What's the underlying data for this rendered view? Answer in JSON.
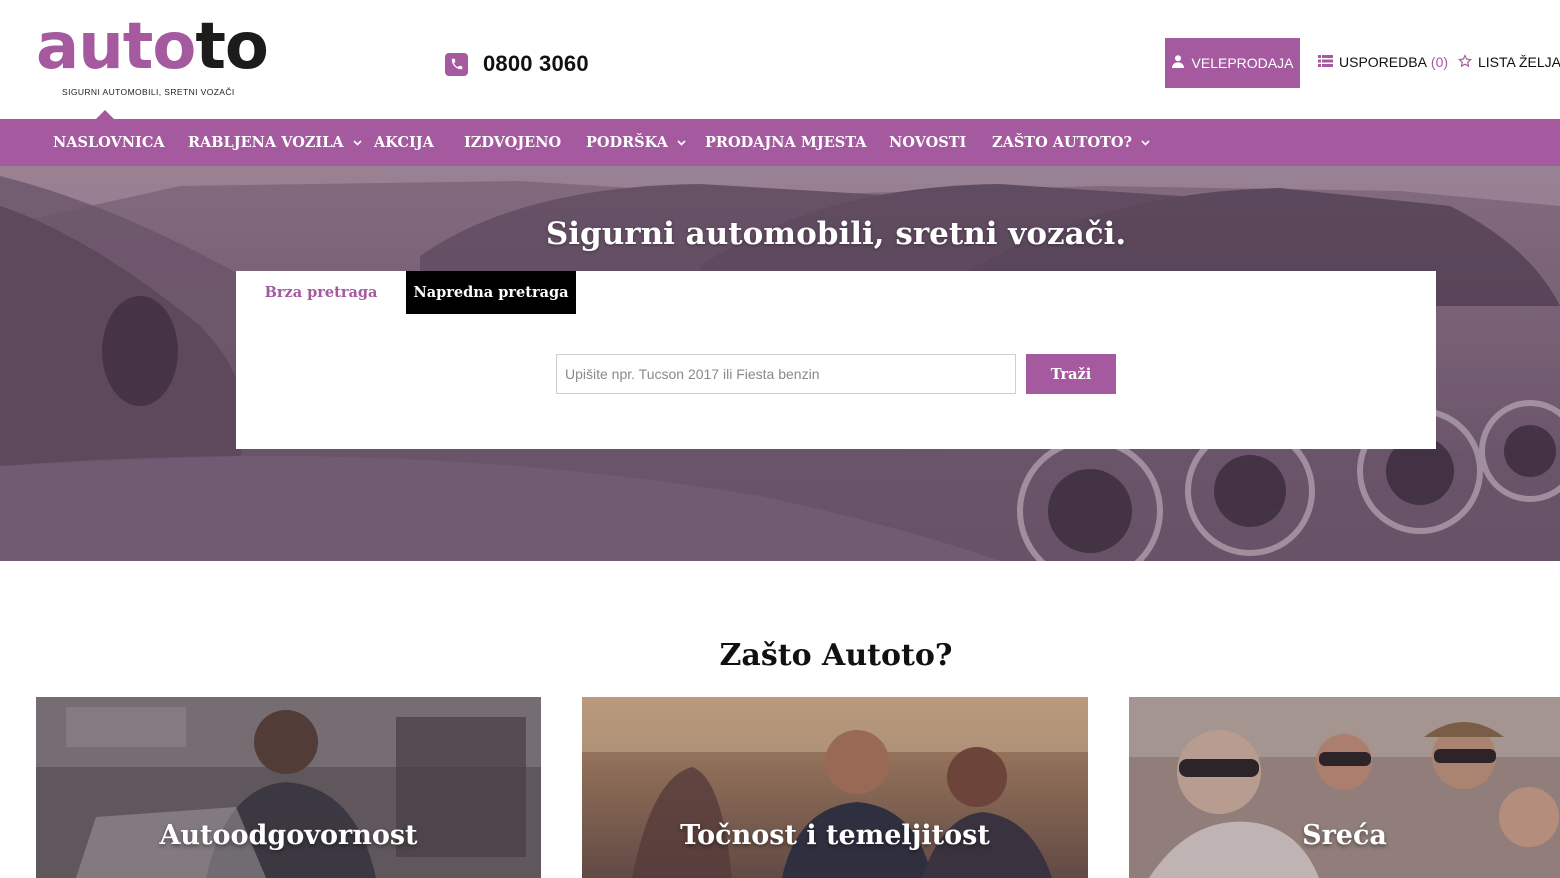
{
  "brand": {
    "logo_prefix": "auto",
    "logo_suffix": "to",
    "tagline": "SIGURNI AUTOMOBILI, SRETNI VOZAČI",
    "accent_color": "#a55a9f"
  },
  "header": {
    "phone_icon": "phone-icon",
    "phone_number": "0800 3060",
    "wholesale_label": "VELEPRODAJA",
    "compare_label": "USPOREDBA",
    "compare_count": "(0)",
    "wishlist_label": "LISTA ŽELJA"
  },
  "nav": {
    "items": [
      {
        "label": "NASLOVNICA",
        "has_dropdown": false,
        "active": true
      },
      {
        "label": "RABLJENA VOZILA",
        "has_dropdown": true
      },
      {
        "label": "AKCIJA",
        "has_dropdown": false
      },
      {
        "label": "IZDVOJENO",
        "has_dropdown": false
      },
      {
        "label": "PODRŠKA",
        "has_dropdown": true
      },
      {
        "label": "PRODAJNA MJESTA",
        "has_dropdown": false
      },
      {
        "label": "NOVOSTI",
        "has_dropdown": false
      },
      {
        "label": "ZAŠTO AUTOTO?",
        "has_dropdown": true
      }
    ]
  },
  "hero": {
    "title": "Sigurni automobili, sretni vozači.",
    "search": {
      "tab_quick": "Brza pretraga",
      "tab_advanced": "Napredna pretraga",
      "active_tab": "Napredna pretraga",
      "placeholder": "Upišite npr. Tucson 2017 ili Fiesta benzin",
      "value": "",
      "button_label": "Traži"
    }
  },
  "why": {
    "title": "Zašto Autoto?",
    "cards": [
      {
        "title": "Autoodgovornost"
      },
      {
        "title": "Točnost i temeljitost"
      },
      {
        "title": "Sreća"
      }
    ]
  }
}
